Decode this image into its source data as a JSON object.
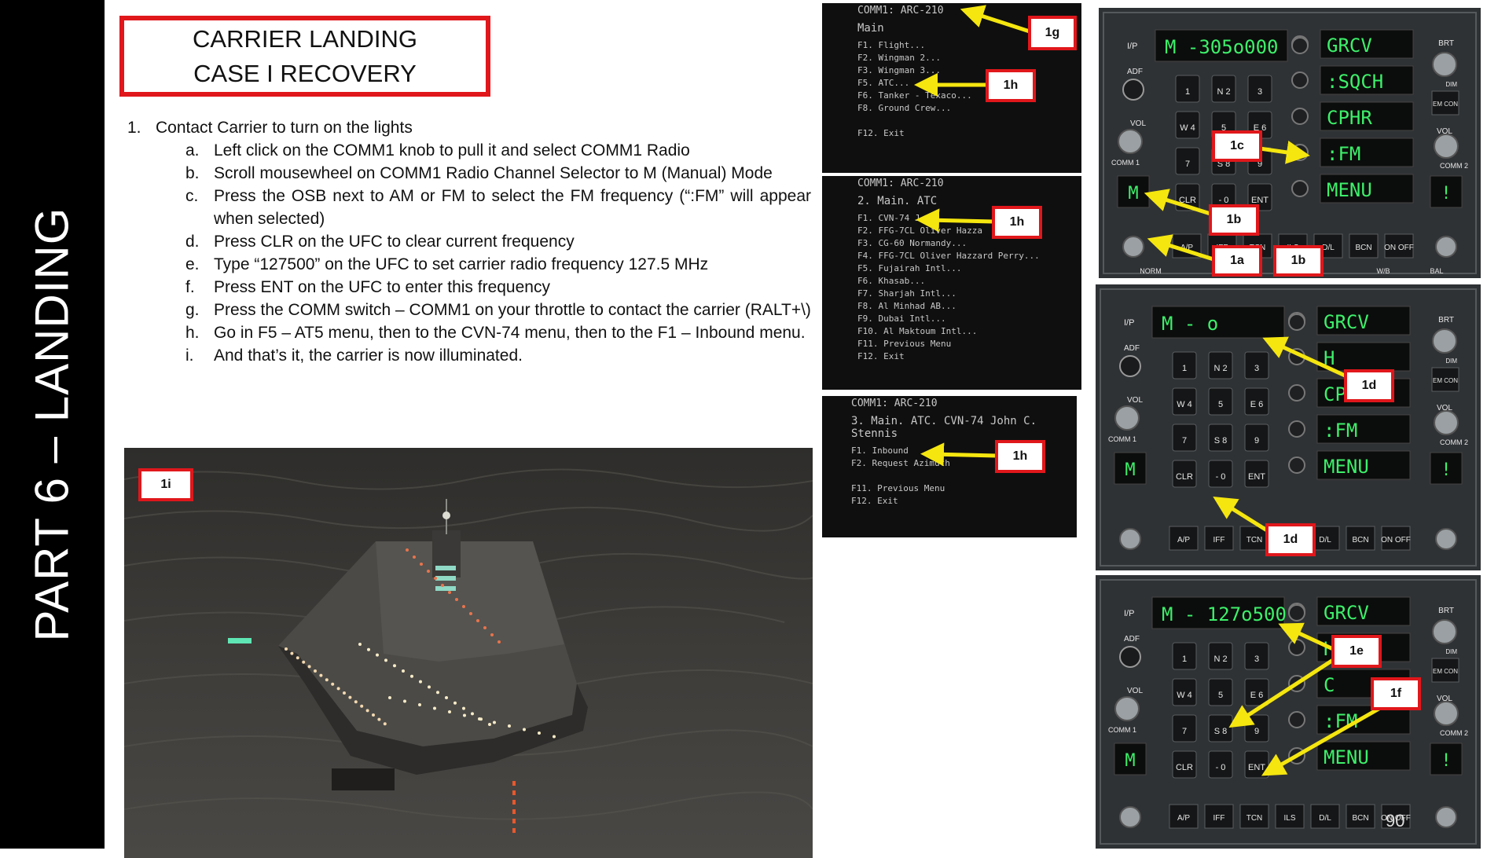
{
  "sidebar": {
    "text": "PART 6 – LANDING"
  },
  "title": {
    "line1": "CARRIER LANDING",
    "line2": "CASE I RECOVERY"
  },
  "steps": {
    "main_number": "1.",
    "main_text": "Contact Carrier to turn on the lights",
    "substeps": [
      {
        "letter": "a.",
        "text": "Left click on the COMM1 knob to pull it and select COMM1 Radio"
      },
      {
        "letter": "b.",
        "text": "Scroll mousewheel on COMM1 Radio Channel Selector to M (Manual) Mode"
      },
      {
        "letter": "c.",
        "text": "Press the OSB next to AM or FM to select the FM frequency (“:FM” will appear when selected)"
      },
      {
        "letter": "d.",
        "text": "Press CLR on the UFC to clear current frequency"
      },
      {
        "letter": "e.",
        "text": "Type “127500” on the UFC to set carrier radio frequency 127.5 MHz"
      },
      {
        "letter": "f.",
        "text": "Press ENT on the UFC to enter this frequency"
      },
      {
        "letter": "g.",
        "text": "Press the COMM switch – COMM1 on your throttle to contact the carrier (RALT+\\)"
      },
      {
        "letter": "h.",
        "text": "Go in F5 – AT5 menu, then to the CVN-74 menu, then to the F1 – Inbound menu."
      },
      {
        "letter": "i.",
        "text": "And that’s it, the carrier is now illuminated."
      }
    ]
  },
  "comm_menus": [
    {
      "header": "COMM1: ARC-210",
      "title": "Main",
      "items": [
        "F1. Flight...",
        "F2. Wingman 2...",
        "F3. Wingman 3...",
        "F5. ATC...",
        "F6. Tanker - Texaco...",
        "F8. Ground Crew...",
        "",
        "F12. Exit"
      ]
    },
    {
      "header": "COMM1: ARC-210",
      "title": "2. Main. ATC",
      "items": [
        "F1. CVN-74 J",
        "F2. FFG-7CL Oliver Hazza",
        "F3. CG-60 Normandy...",
        "F4. FFG-7CL Oliver Hazzard Perry...",
        "F5. Fujairah Intl...",
        "F6. Khasab...",
        "F7. Sharjah Intl...",
        "F8. Al Minhad AB...",
        "F9. Dubai Intl...",
        "F10. Al Maktoum Intl...",
        "F11. Previous Menu",
        "F12. Exit"
      ]
    },
    {
      "header": "COMM1: ARC-210",
      "title": "3. Main. ATC. CVN-74 John C. Stennis",
      "items": [
        "F1. Inbound",
        "F2. Request Azimuth",
        "",
        "F11. Previous Menu",
        "F12. Exit"
      ]
    }
  ],
  "callouts": {
    "c1g": "1g",
    "c1h_a": "1h",
    "c1h_b": "1h",
    "c1h_c": "1h",
    "c1c": "1c",
    "c1b_a": "1b",
    "c1a": "1a",
    "c1b_b": "1b",
    "c1d_a": "1d",
    "c1d_b": "1d",
    "c1e": "1e",
    "c1f": "1f",
    "c1i": "1i"
  },
  "ufc_panels": [
    {
      "scratchpad": "M -305o000",
      "options": [
        "GRCV",
        ":SQCH",
        "CPHR",
        ":FM",
        "MENU"
      ],
      "left_channel": "M",
      "right_channel": "!"
    },
    {
      "scratchpad": "M -      o",
      "options": [
        "GRCV",
        "H",
        "CPHR",
        ":FM",
        "MENU"
      ],
      "left_channel": "M",
      "right_channel": "!"
    },
    {
      "scratchpad": "M - 127o500",
      "options": [
        "GRCV",
        "H",
        "C",
        ":FM",
        "MENU"
      ],
      "left_channel": "M",
      "right_channel": "!"
    }
  ],
  "ufc_labels": {
    "ip": "I/P",
    "adf": "ADF",
    "vol": "VOL",
    "comm1": "COMM 1",
    "comm2": "COMM 2",
    "brt": "BRT",
    "dim": "DIM",
    "emcon": "EM CON",
    "norm": "NORM",
    "wb": "W/B",
    "bal": "BAL",
    "keys": [
      "1",
      "N 2",
      "3",
      "W 4",
      "5",
      "E 6",
      "7",
      "S 8",
      "9",
      "CLR",
      "- 0",
      "ENT"
    ],
    "bottom": [
      "A/P",
      "IFF",
      "TCN",
      "ILS",
      "D/L",
      "BCN",
      "ON OFF"
    ]
  },
  "page_number": "90",
  "colors": {
    "callout_border": "#e0171b",
    "arrow": "#f5e60f",
    "ufc_green": "#3df06a"
  }
}
